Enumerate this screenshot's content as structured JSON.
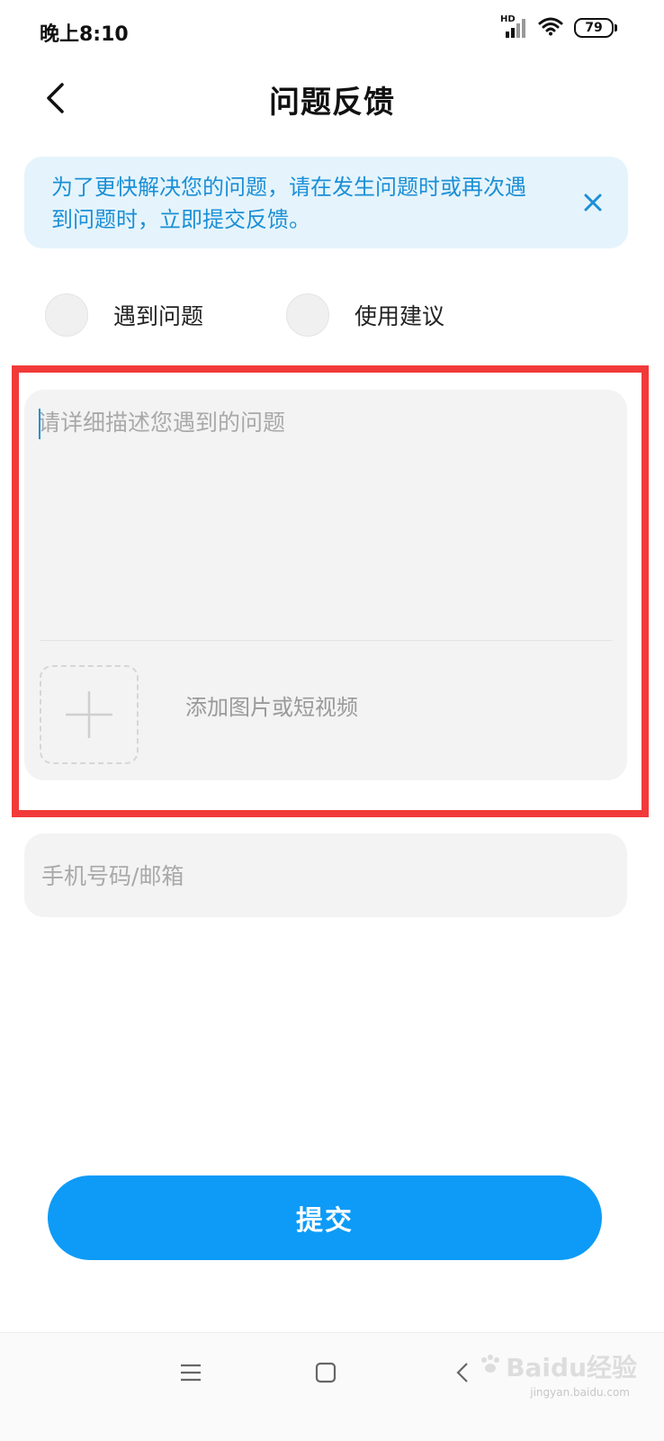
{
  "status_bar": {
    "time": "晚上8:10",
    "network_label": "HD",
    "battery": "79"
  },
  "header": {
    "title": "问题反馈",
    "back_icon": "chevron-left-icon"
  },
  "notice": {
    "text": "为了更快解决您的问题，请在发生问题时或再次遇到问题时，立即提交反馈。",
    "close_icon": "close-icon"
  },
  "feedback_types": [
    {
      "label": "遇到问题",
      "selected": false
    },
    {
      "label": "使用建议",
      "selected": false
    }
  ],
  "description": {
    "placeholder": "请详细描述您遇到的问题",
    "value": ""
  },
  "attachment": {
    "label": "添加图片或短视频",
    "icon": "plus-icon"
  },
  "contact": {
    "placeholder": "手机号码/邮箱",
    "value": ""
  },
  "submit_label": "提交",
  "nav_bar": {
    "items": [
      "menu-icon",
      "home-square-icon",
      "back-triangle-icon"
    ]
  },
  "watermark": {
    "text": "Baidu经验",
    "sub": "jingyan.baidu.com"
  },
  "colors": {
    "accent": "#0d9bf7",
    "notice_bg": "#e5f4fc",
    "notice_text": "#1b8fd6",
    "highlight": "#f23a3a",
    "field_bg": "#f3f3f3"
  }
}
